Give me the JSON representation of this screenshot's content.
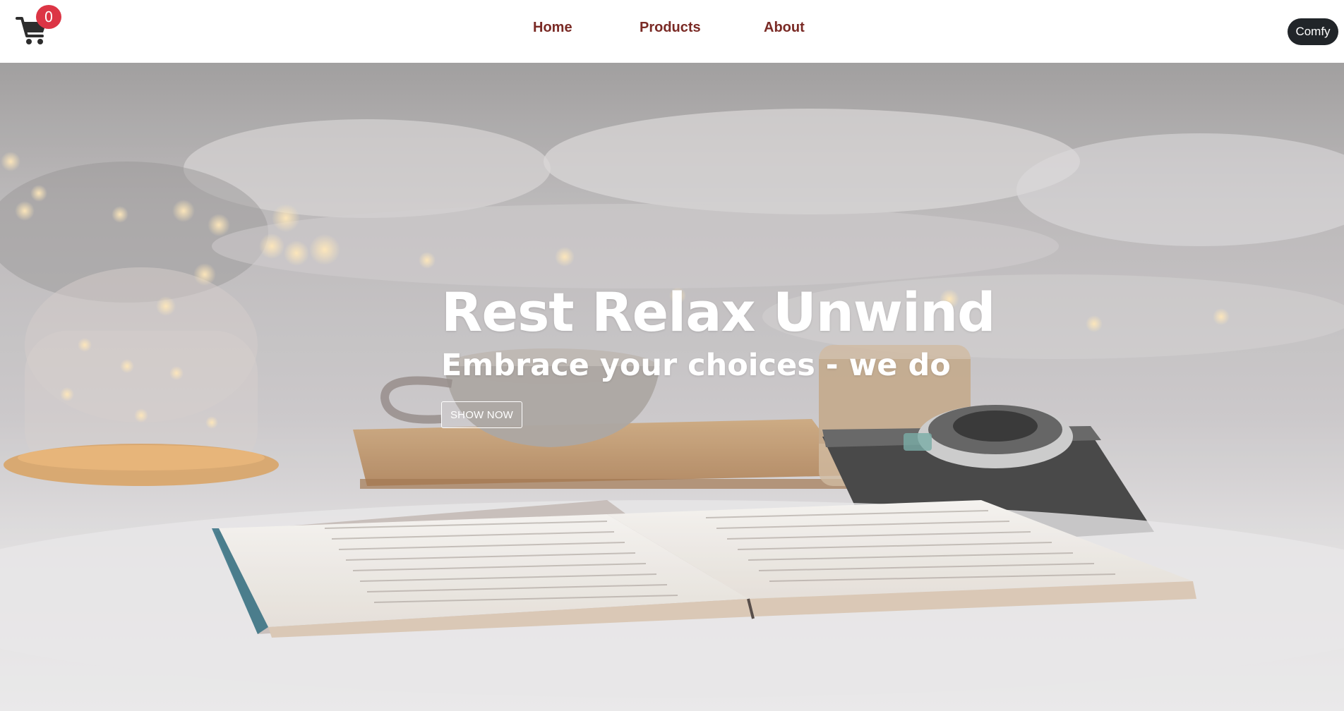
{
  "navbar": {
    "cart": {
      "icon": "shopping-cart-icon",
      "count": "0",
      "badge_color": "#dc3545"
    },
    "links": [
      {
        "label": "Home"
      },
      {
        "label": "Products"
      },
      {
        "label": "About"
      }
    ],
    "link_color": "#7a2a25",
    "brand": {
      "label": "Comfy",
      "background": "#212529"
    }
  },
  "hero": {
    "title": "Rest Relax Unwind",
    "subtitle": "Embrace your choices - we do",
    "button_label": "SHOW NOW"
  }
}
